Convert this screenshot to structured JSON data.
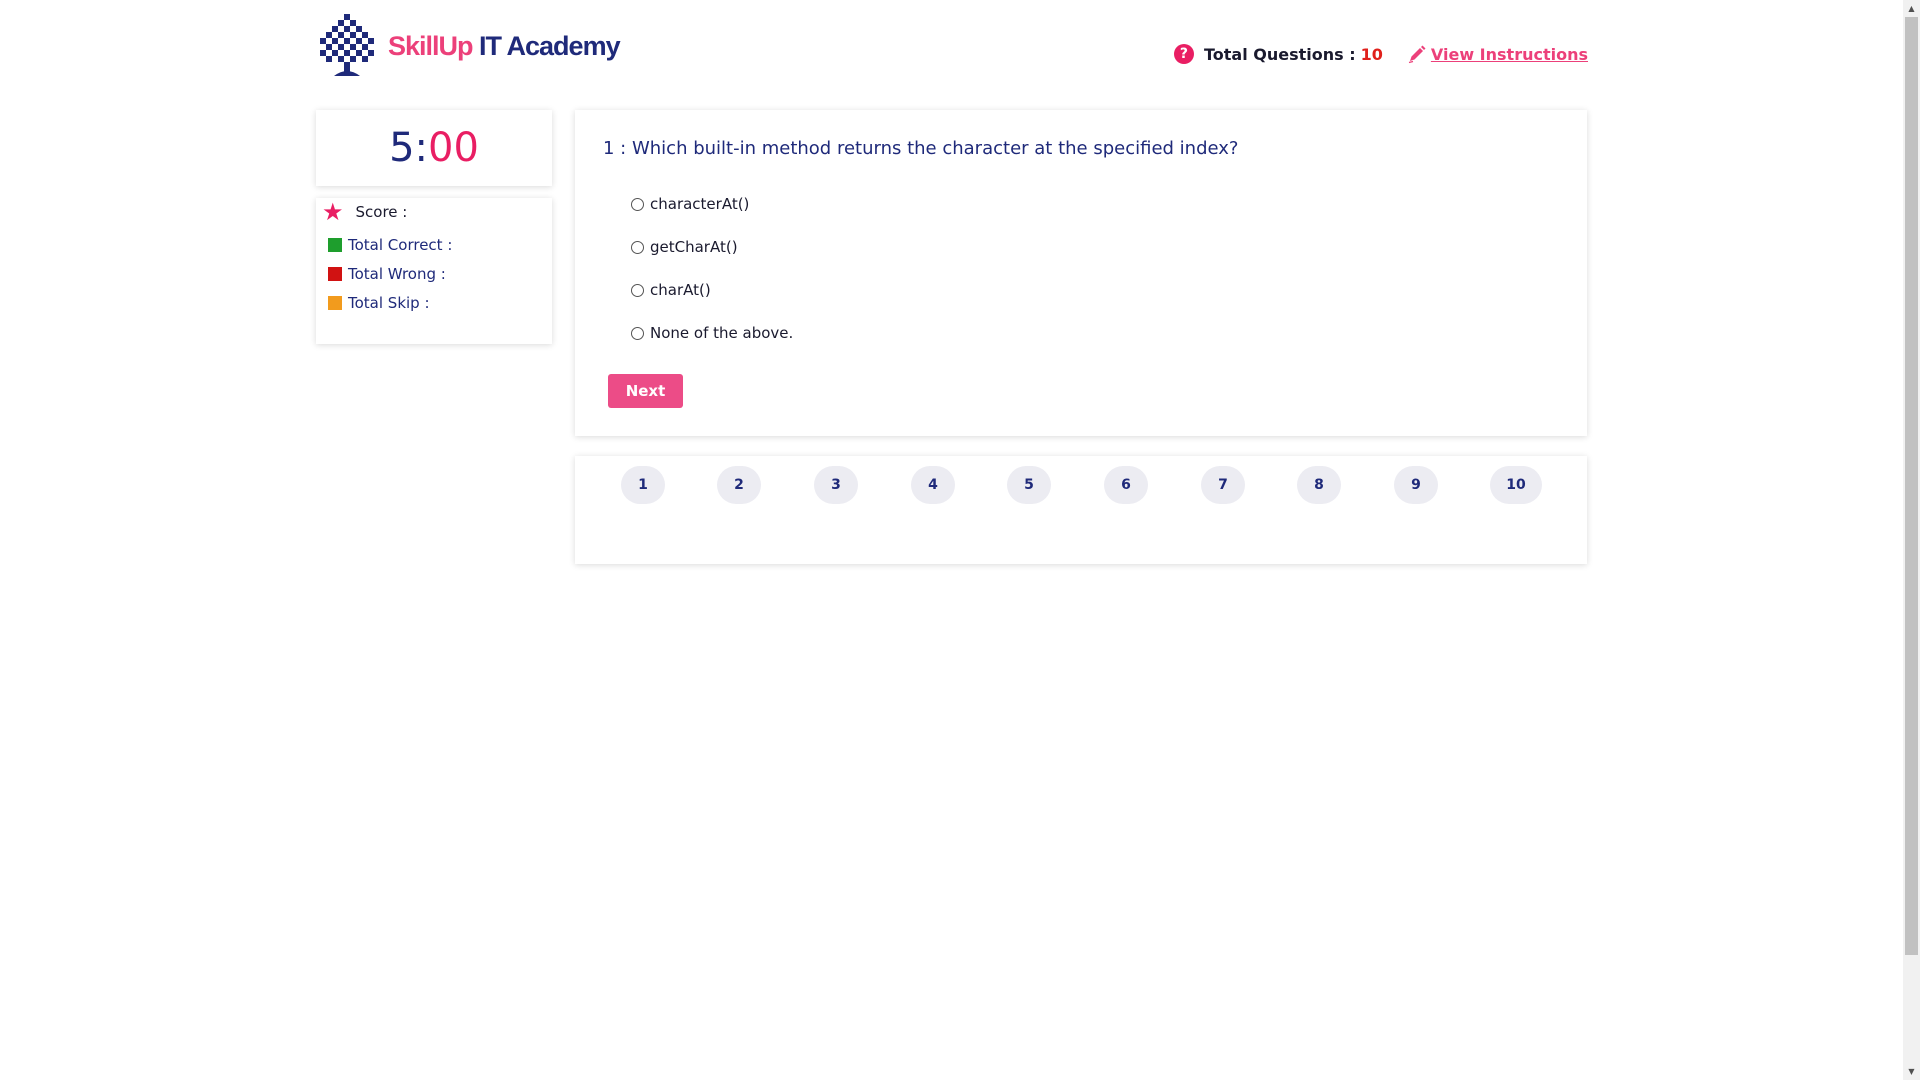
{
  "brand": {
    "name_part1": "SkillUp",
    "name_part2": " IT Academy"
  },
  "header": {
    "total_questions_label": "Total Questions :",
    "total_questions_value": "10",
    "view_instructions": " View Instructions"
  },
  "timer": {
    "minutes": "5",
    "separator": ":",
    "seconds": "00"
  },
  "score": {
    "title": "Score :",
    "correct_label": "Total Correct :",
    "wrong_label": "Total Wrong :",
    "skip_label": "Total Skip :"
  },
  "question": {
    "text": "1 : Which built-in method returns the character at the specified index?",
    "options": [
      "characterAt()",
      "getCharAt()",
      "charAt()",
      "None of the above."
    ],
    "next_label": "Next"
  },
  "navigator": {
    "numbers": [
      "1",
      "2",
      "3",
      "4",
      "5",
      "6",
      "7",
      "8",
      "9",
      "10"
    ]
  },
  "colors": {
    "accent": "#e91e63",
    "primary": "#1f2a7a",
    "correct": "#1e9e2d",
    "wrong": "#d11212",
    "skip": "#f29b1d"
  }
}
